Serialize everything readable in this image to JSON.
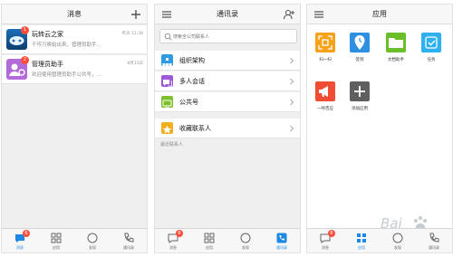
{
  "screens": {
    "messages": {
      "title": "消息",
      "chats": [
        {
          "name": "玩转云之家",
          "time": "昨天 11:38",
          "preview": "干哼万唤始出来，管理员助手…",
          "badge": "1"
        },
        {
          "name": "管理员助手",
          "time": "8月13日",
          "preview": "欢迎使用管理员助手公共号，…",
          "badge": "2"
        }
      ]
    },
    "contacts": {
      "title": "通讯录",
      "search_placeholder": "搜索全公司联系人",
      "rows": [
        {
          "label": "组织架构",
          "color": "#2f9be3"
        },
        {
          "label": "多人会话",
          "color": "#9c5ad8"
        },
        {
          "label": "公共号",
          "color": "#7cbf2a"
        },
        {
          "label": "收藏联系人",
          "color": "#f2b01e"
        }
      ],
      "recent_label": "最近联系人"
    },
    "apps": {
      "title": "应用",
      "items": [
        {
          "label": "扫一扫",
          "color": "#f7a21b",
          "icon": "qr-scan-icon"
        },
        {
          "label": "签到",
          "color": "#2f8fe0",
          "icon": "location-pin-icon"
        },
        {
          "label": "文档助手",
          "color": "#6bbf2b",
          "icon": "folder-icon"
        },
        {
          "label": "任务",
          "color": "#2fb1f0",
          "icon": "check-icon"
        },
        {
          "label": "一呼百应",
          "color": "#f04b33",
          "icon": "megaphone-icon"
        },
        {
          "label": "添加应用",
          "color": "#5f5f5f",
          "icon": "plus-icon"
        }
      ]
    }
  },
  "tabs": {
    "labels": [
      "消息",
      "应用",
      "发现",
      "通讯录"
    ],
    "badge_p1": "6",
    "badge_p2": "6",
    "badge_p3": "6"
  },
  "colors": {
    "accent": "#1e88e5",
    "badge": "#ff4d3a"
  },
  "watermark": {
    "brand": "Bai",
    "suffix": "百度"
  }
}
